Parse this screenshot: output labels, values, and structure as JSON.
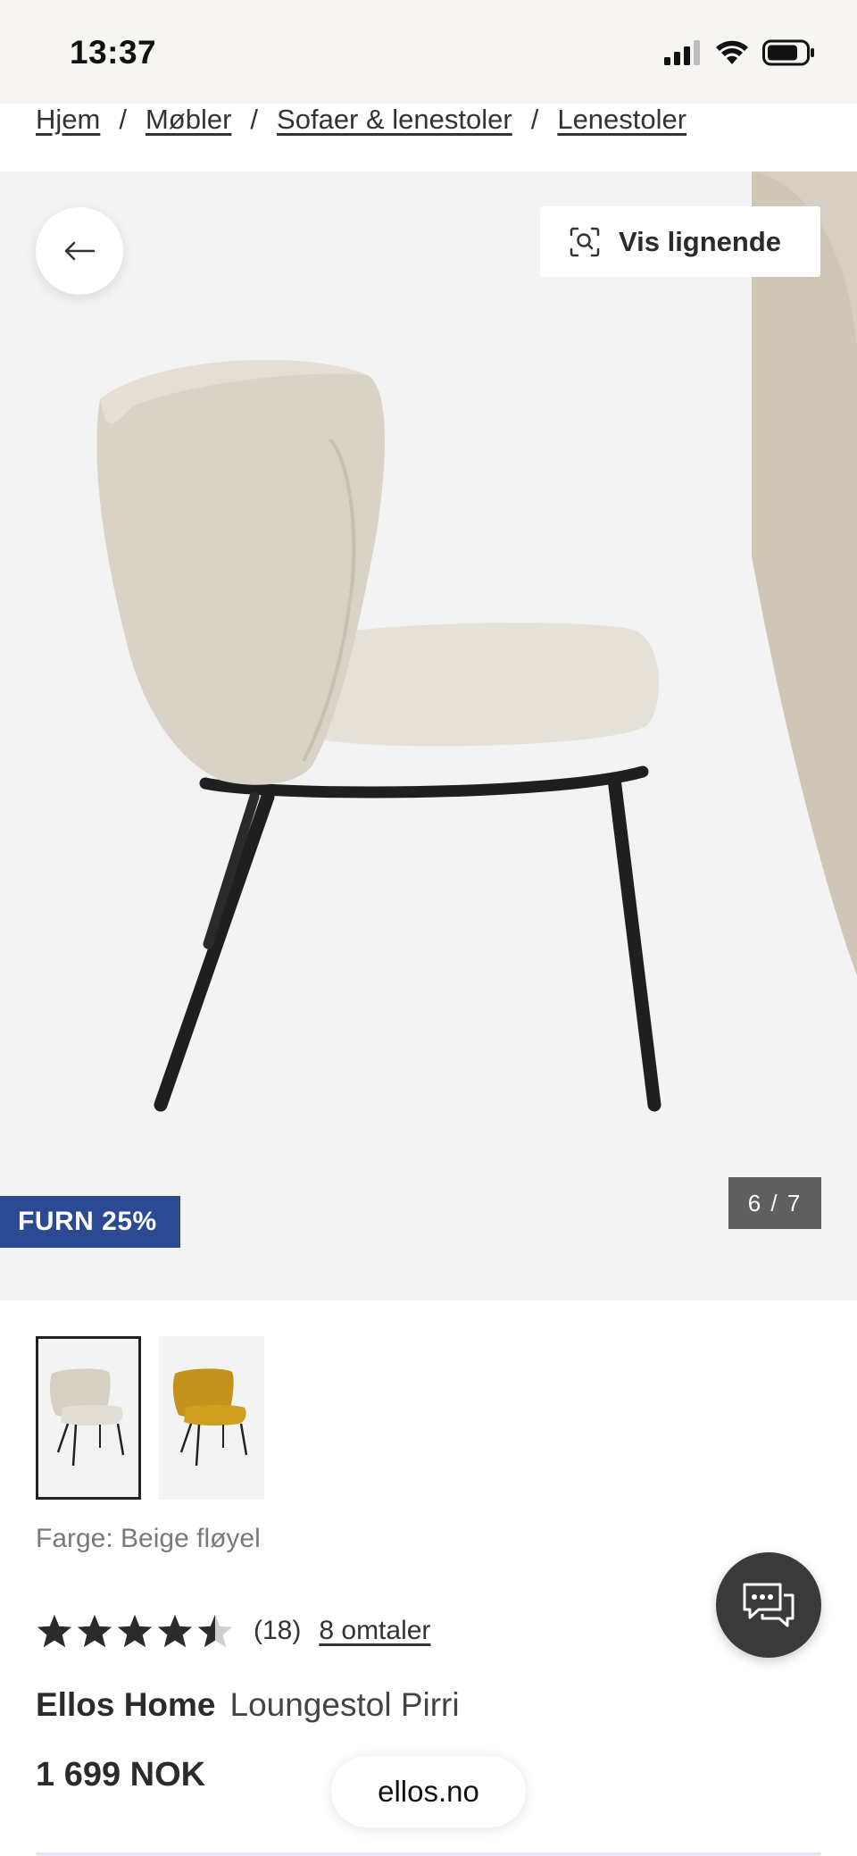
{
  "status_bar": {
    "time": "13:37",
    "icons": [
      "signal-icon",
      "wifi-icon",
      "battery-icon"
    ]
  },
  "breadcrumb": {
    "items": [
      "Hjem",
      "Møbler",
      "Sofaer & lenestoler",
      "Lenestoler"
    ],
    "separator": "/"
  },
  "gallery": {
    "back_icon": "arrow-left-icon",
    "similar_button": {
      "icon": "visual-search-icon",
      "label": "Vis lignende"
    },
    "promo_badge": "FURN 25%",
    "counter": "6 / 7"
  },
  "variants": [
    {
      "name": "Beige fløyel",
      "selected": true,
      "color": "#d9d3c8"
    },
    {
      "name": "Mustard",
      "selected": false,
      "color": "#c89a1e"
    }
  ],
  "product": {
    "color_label": "Farge: Beige fløyel",
    "rating": 4.5,
    "rating_max": 5,
    "rating_count": "(18)",
    "reviews_link": "8 omtaler",
    "brand": "Ellos Home",
    "name": "Loungestol Pirri",
    "price": "1 699 NOK"
  },
  "chat": {
    "icon": "chat-bubbles-icon"
  },
  "browser": {
    "url": "ellos.no"
  },
  "colors": {
    "promo_blue": "#2a4a94",
    "counter_gray": "#5f5f5f",
    "gallery_bg": "#f3f3f3",
    "chair_fabric": "#ddd6cb",
    "chair_legs": "#1f1f1f"
  }
}
